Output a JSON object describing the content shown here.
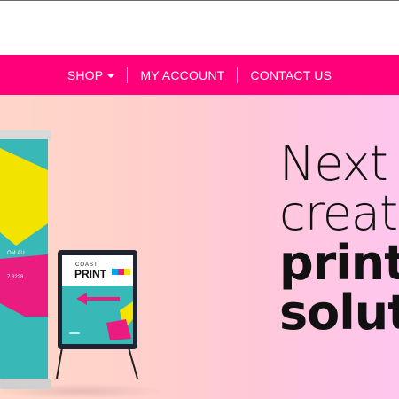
{
  "colors": {
    "brand_pink": "#ff007a",
    "hero_gradient_left": "#ffd7c8",
    "hero_gradient_right": "#ffc6ef",
    "hero_text": "#111111",
    "teal": "#39b8b8",
    "yellow": "#f3e400",
    "magenta": "#ea1c7f"
  },
  "nav": {
    "items": [
      {
        "label": "SHOP",
        "has_caret": true
      },
      {
        "label": "MY ACCOUNT"
      },
      {
        "label": "CONTACT US"
      }
    ]
  },
  "hero": {
    "headline_lines": [
      "Next",
      "creat",
      "print",
      "solut"
    ]
  },
  "products": {
    "banner": {
      "text_line1": "OM.AU",
      "text_line2": "7 3228"
    },
    "aframe": {
      "logo_top": "COAST",
      "logo_main": "PRINT"
    }
  }
}
